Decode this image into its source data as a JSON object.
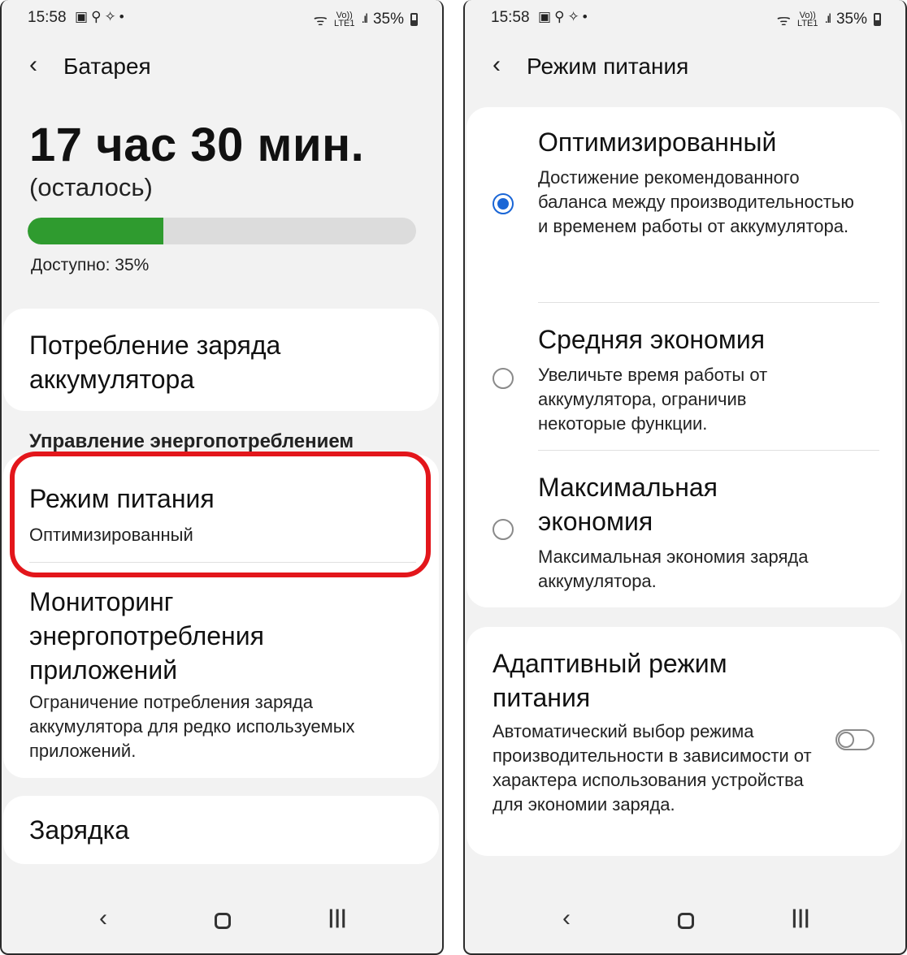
{
  "left_screen": {
    "status_bar": {
      "time": "15:58",
      "net_top": "Vo))",
      "net_bottom": "LTE1",
      "battery": "35%"
    },
    "header": {
      "title": "Батарея"
    },
    "battery_time": "17 час 30 мин.",
    "battery_time_caption": "(осталось)",
    "battery_level": 0.35,
    "available": "Доступно: 35%",
    "usage": {
      "title": "Потребление заряда аккумулятора"
    },
    "section_label": "Управление энергопотреблением",
    "power_mode": {
      "title": "Режим питания",
      "value": "Оптимизированный"
    },
    "app_monitor": {
      "title": "Мониторинг энергопотребления приложений",
      "description": "Ограничение потребления заряда аккумулятора для редко используемых приложений."
    },
    "charging": {
      "title": "Зарядка"
    },
    "highlight_color": "#e3161b",
    "progress_color": "#2f9b2f"
  },
  "right_screen": {
    "status_bar": {
      "time": "15:58",
      "net_top": "Vo))",
      "net_bottom": "LTE1",
      "battery": "35%"
    },
    "header": {
      "title": "Режим питания"
    },
    "options": [
      {
        "title": "Оптимизированный",
        "description": "Достижение рекомендованного баланса между производительностью и временем работы от аккумулятора.",
        "selected": true
      },
      {
        "title": "Средняя экономия",
        "description": "Увеличьте время работы от аккумулятора, ограничив некоторые функции.",
        "selected": false
      },
      {
        "title": "Максимальная экономия",
        "description": "Максимальная экономия заряда аккумулятора.",
        "selected": false
      }
    ],
    "adaptive": {
      "title": "Адаптивный режим питания",
      "description": "Автоматический выбор режима производительности в зависимости от характера использования устройства для экономии заряда.",
      "enabled": false
    },
    "accent_color": "#1a66d6"
  },
  "icons": {
    "status_left": [
      "gallery-icon",
      "search-icon",
      "magic-wand-icon",
      "dot-icon"
    ],
    "status_right": [
      "wifi-icon",
      "signal-icon",
      "battery-icon"
    ],
    "nav": [
      "nav-back-icon",
      "nav-home-icon",
      "nav-recents-icon"
    ],
    "back": "chevron-left-icon"
  }
}
